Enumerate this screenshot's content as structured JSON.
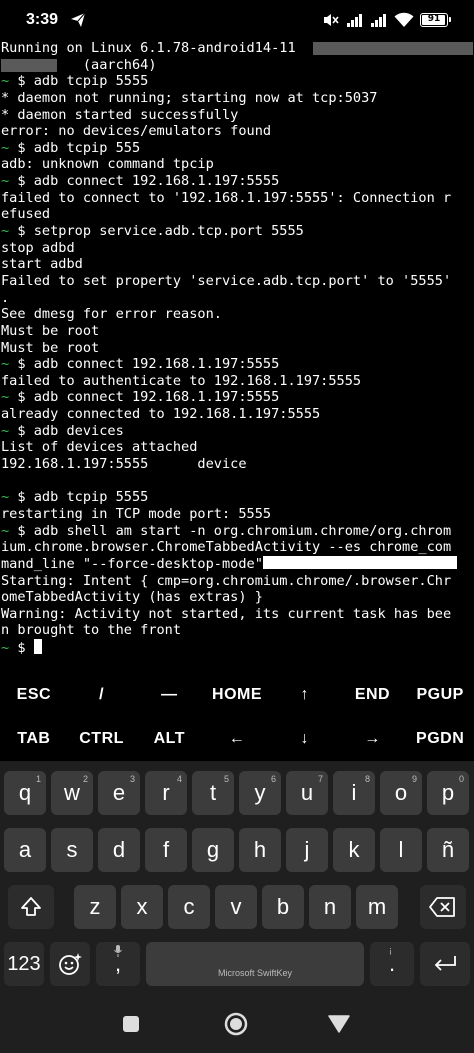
{
  "status_bar": {
    "time": "3:39",
    "battery": "91",
    "icons": [
      "telegram-send-icon",
      "mute-icon",
      "signal-icon",
      "signal-icon",
      "wifi-icon",
      "battery-icon"
    ]
  },
  "terminal": {
    "lines": [
      {
        "text": "Running on Linux 6.1.78-android14-11",
        "tilde": false
      },
      {
        "text": "          (aarch64)",
        "tilde": false
      },
      {
        "text": " $ adb tcpip 5555",
        "tilde": true
      },
      {
        "text": "* daemon not running; starting now at tcp:5037",
        "tilde": false
      },
      {
        "text": "* daemon started successfully",
        "tilde": false
      },
      {
        "text": "error: no devices/emulators found",
        "tilde": false
      },
      {
        "text": " $ adb tcpip 555",
        "tilde": true
      },
      {
        "text": "adb: unknown command tpcip",
        "tilde": false
      },
      {
        "text": " $ adb connect 192.168.1.197:5555",
        "tilde": true
      },
      {
        "text": "failed to connect to '192.168.1.197:5555': Connection r",
        "tilde": false
      },
      {
        "text": "efused",
        "tilde": false
      },
      {
        "text": " $ setprop service.adb.tcp.port 5555",
        "tilde": true
      },
      {
        "text": "stop adbd",
        "tilde": false
      },
      {
        "text": "start adbd",
        "tilde": false
      },
      {
        "text": "Failed to set property 'service.adb.tcp.port' to '5555'",
        "tilde": false
      },
      {
        "text": ".",
        "tilde": false
      },
      {
        "text": "See dmesg for error reason.",
        "tilde": false
      },
      {
        "text": "Must be root",
        "tilde": false
      },
      {
        "text": "Must be root",
        "tilde": false
      },
      {
        "text": " $ adb connect 192.168.1.197:5555",
        "tilde": true
      },
      {
        "text": "failed to authenticate to 192.168.1.197:5555",
        "tilde": false
      },
      {
        "text": " $ adb connect 192.168.1.197:5555",
        "tilde": true
      },
      {
        "text": "already connected to 192.168.1.197:5555",
        "tilde": false
      },
      {
        "text": " $ adb devices",
        "tilde": true
      },
      {
        "text": "List of devices attached",
        "tilde": false
      },
      {
        "text": "192.168.1.197:5555      device",
        "tilde": false
      },
      {
        "text": "",
        "tilde": false
      },
      {
        "text": " $ adb tcpip 5555",
        "tilde": true
      },
      {
        "text": "restarting in TCP mode port: 5555",
        "tilde": false
      },
      {
        "text": " $ adb shell am start -n org.chromium.chrome/org.chrom",
        "tilde": true
      },
      {
        "text": "ium.chrome.browser.ChromeTabbedActivity --es chrome_com",
        "tilde": false
      },
      {
        "text": "mand_line \"--force-desktop-mode\"",
        "tilde": false
      },
      {
        "text": "Starting: Intent { cmp=org.chromium.chrome/.browser.Chr",
        "tilde": false
      },
      {
        "text": "omeTabbedActivity (has extras) }",
        "tilde": false
      },
      {
        "text": "Warning: Activity not started, its current task has bee",
        "tilde": false
      },
      {
        "text": "n brought to the front",
        "tilde": false
      },
      {
        "text": " $ ",
        "tilde": true
      }
    ],
    "tilde_char": "~"
  },
  "extra_keys": {
    "row1": [
      "ESC",
      "/",
      "—",
      "HOME",
      "↑",
      "END",
      "PGUP"
    ],
    "row2": [
      "TAB",
      "CTRL",
      "ALT",
      "←",
      "↓",
      "→",
      "PGDN"
    ]
  },
  "keyboard": {
    "row1": [
      "q",
      "w",
      "e",
      "r",
      "t",
      "y",
      "u",
      "i",
      "o",
      "p"
    ],
    "row1_hints": [
      "1",
      "2",
      "3",
      "4",
      "5",
      "6",
      "7",
      "8",
      "9",
      "0"
    ],
    "row2": [
      "a",
      "s",
      "d",
      "f",
      "g",
      "h",
      "j",
      "k",
      "l",
      "ñ"
    ],
    "row3": [
      "z",
      "x",
      "c",
      "v",
      "b",
      "n",
      "m"
    ],
    "numbers_label": "123",
    "space_label": "Microsoft SwiftKey",
    "comma": ",",
    "period": "."
  }
}
